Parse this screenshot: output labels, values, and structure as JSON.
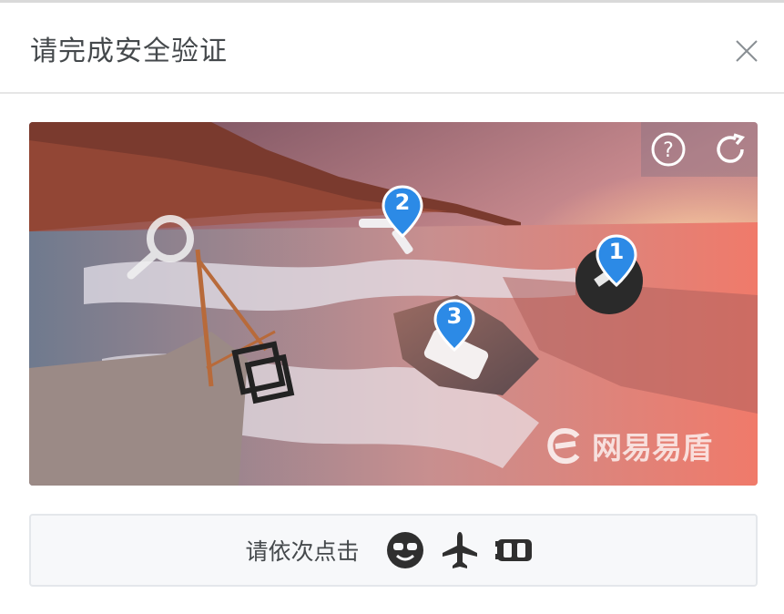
{
  "dialog": {
    "title": "请完成安全验证",
    "close_icon": "close-icon"
  },
  "captcha": {
    "tools": {
      "help_icon": "help-circle-icon",
      "refresh_icon": "refresh-icon"
    },
    "markers": [
      {
        "label": "1"
      },
      {
        "label": "2"
      },
      {
        "label": "3"
      }
    ],
    "watermark_text": "网易易盾"
  },
  "prompt": {
    "text": "请依次点击",
    "targets": [
      "smiley-sunglasses-icon",
      "airplane-icon",
      "car-icon"
    ]
  },
  "colors": {
    "marker_blue": "#2c8ae6",
    "title_text": "#45494c",
    "prompt_bg": "#f7f8fa"
  }
}
